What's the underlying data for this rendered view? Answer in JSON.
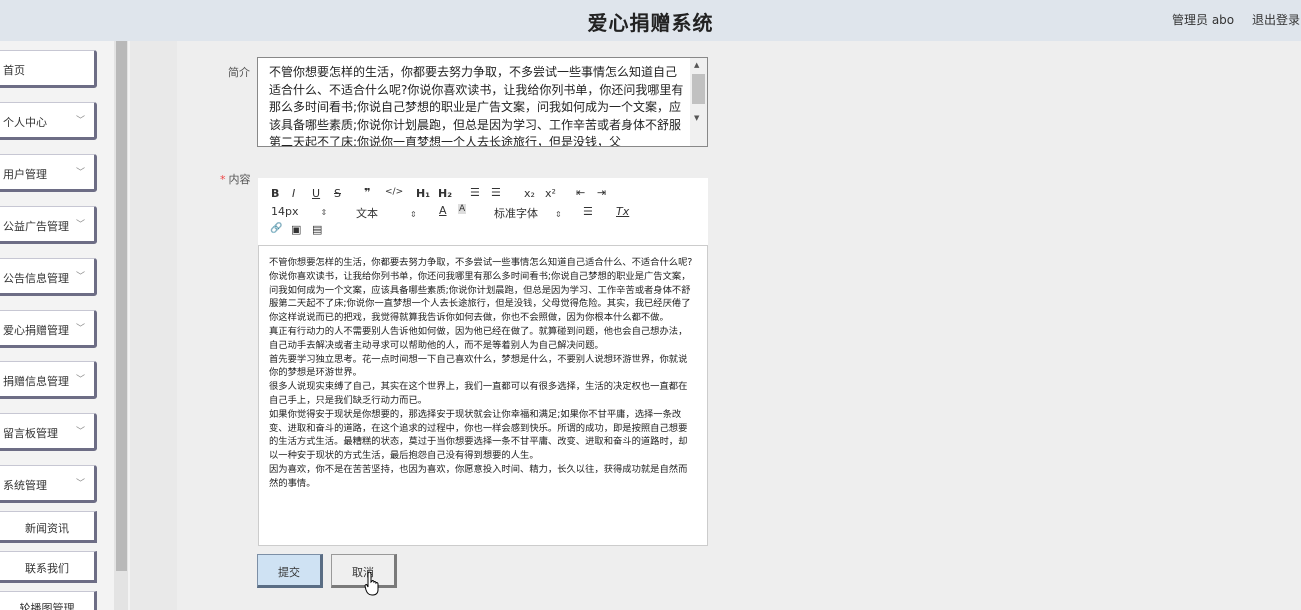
{
  "header": {
    "title": "爱心捐赠系统",
    "user": "管理员 abo",
    "logout": "退出登录"
  },
  "sidebar": {
    "items": [
      {
        "label": "首页",
        "chevron": false
      },
      {
        "label": "个人中心",
        "chevron": true
      },
      {
        "label": "用户管理",
        "chevron": true
      },
      {
        "label": "公益广告管理",
        "chevron": true
      },
      {
        "label": "公告信息管理",
        "chevron": true
      },
      {
        "label": "爱心捐赠管理",
        "chevron": true
      },
      {
        "label": "捐赠信息管理",
        "chevron": true
      },
      {
        "label": "留言板管理",
        "chevron": true
      },
      {
        "label": "系统管理",
        "chevron": true
      }
    ],
    "sub_items": [
      "新闻资讯",
      "联系我们",
      "轮播图管理"
    ]
  },
  "form": {
    "intro_label": "简介",
    "intro_text": "不管你想要怎样的生活，你都要去努力争取，不多尝试一些事情怎么知道自己适合什么、不适合什么呢?你说你喜欢读书，让我给你列书单，你还问我哪里有那么多时间看书;你说自己梦想的职业是广告文案，问我如何成为一个文案，应该具备哪些素质;你说你计划晨跑，但总是因为学习、工作辛苦或者身体不舒服第二天起不了床;你说你一直梦想一个人去长途旅行，但是没钱，父",
    "content_label": "内容",
    "content_required": "*",
    "toolbar": {
      "bold": "B",
      "italic": "I",
      "underline": "U",
      "strike": "S",
      "quote": "❞",
      "code": "</>",
      "h1": "H₁",
      "h2": "H₂",
      "ol": "☰",
      "ul": "☰",
      "sub": "x₂",
      "sup": "x²",
      "outdent": "⇤",
      "indent": "⇥",
      "size": "14px",
      "type": "文本",
      "color": "A",
      "bg": "A",
      "font": "标准字体",
      "align": "☰",
      "clean": "Tx",
      "link": "🔗",
      "image": "▣",
      "video": "▤"
    },
    "content_paragraphs": [
      "不管你想要怎样的生活，你都要去努力争取，不多尝试一些事情怎么知道自己适合什么、不适合什么呢?",
      "你说你喜欢读书，让我给你列书单，你还问我哪里有那么多时间看书;你说自己梦想的职业是广告文案，问我如何成为一个文案，应该具备哪些素质;你说你计划晨跑，但总是因为学习、工作辛苦或者身体不舒服第二天起不了床;你说你一直梦想一个人去长途旅行，但是没钱，父母觉得危险。其实，我已经厌倦了你这样说说而已的把戏，我觉得就算我告诉你如何去做，你也不会照做，因为你根本什么都不做。",
      "真正有行动力的人不需要别人告诉他如何做，因为他已经在做了。就算碰到问题，他也会自己想办法，自己动手去解决或者主动寻求可以帮助他的人，而不是等着别人为自己解决问题。",
      "首先要学习独立思考。花一点时间想一下自己喜欢什么，梦想是什么，不要别人说想环游世界，你就说你的梦想是环游世界。",
      "很多人说现实束缚了自己，其实在这个世界上，我们一直都可以有很多选择，生活的决定权也一直都在自己手上，只是我们缺乏行动力而已。",
      "如果你觉得安于现状是你想要的，那选择安于现状就会让你幸福和满足;如果你不甘平庸，选择一条改变、进取和奋斗的道路，在这个追求的过程中，你也一样会感到快乐。所谓的成功，即是按照自己想要的生活方式生活。最糟糕的状态，莫过于当你想要选择一条不甘平庸、改变、进取和奋斗的道路时，却以一种安于现状的方式生活，最后抱怨自己没有得到想要的人生。",
      "因为喜欢，你不是在苦苦坚持，也因为喜欢，你愿意投入时间、精力，长久以往，获得成功就是自然而然的事情。"
    ],
    "submit": "提交",
    "cancel": "取消"
  }
}
